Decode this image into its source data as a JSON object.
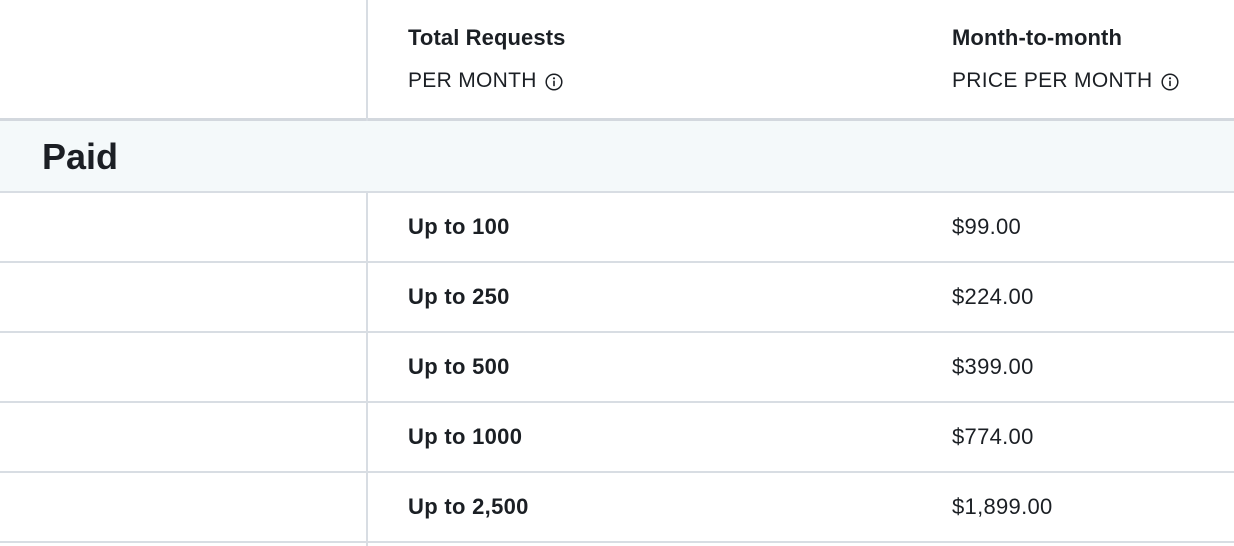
{
  "header": {
    "columns": [
      {
        "title": "Total Requests",
        "subtitle": "PER MONTH",
        "icon": "info-icon"
      },
      {
        "title": "Month-to-month",
        "subtitle": "PRICE PER MONTH",
        "icon": "info-icon"
      }
    ]
  },
  "section": {
    "title": "Paid"
  },
  "rows": [
    {
      "requests": "Up to 100",
      "price": "$99.00"
    },
    {
      "requests": "Up to 250",
      "price": "$224.00"
    },
    {
      "requests": "Up to 500",
      "price": "$399.00"
    },
    {
      "requests": "Up to 1000",
      "price": "$774.00"
    },
    {
      "requests": "Up to 2,500",
      "price": "$1,899.00"
    }
  ],
  "colors": {
    "text": "#1b1f24",
    "divider": "#d8dde3",
    "section_bg": "#f4f9fa"
  }
}
